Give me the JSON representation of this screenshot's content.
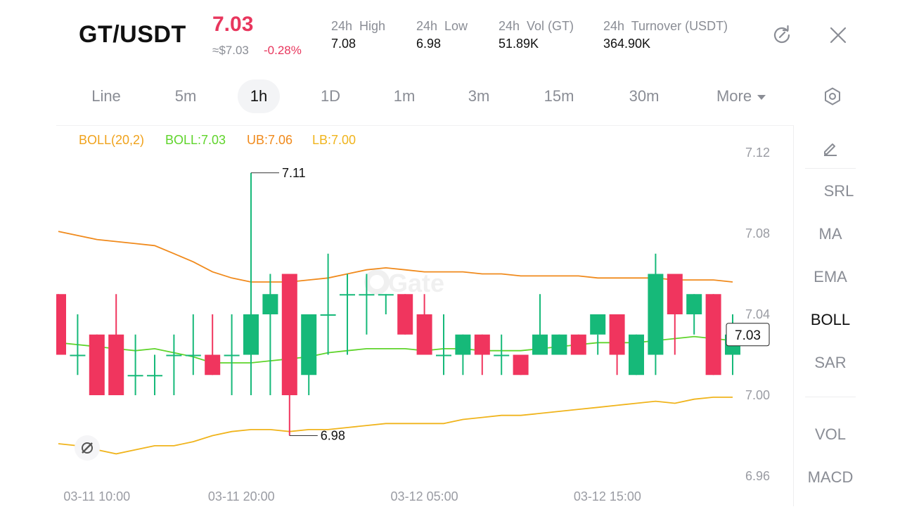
{
  "header": {
    "pair": "GT/USDT",
    "price": "7.03",
    "usd_price": "≈$7.03",
    "change": "-0.28%",
    "stats": [
      {
        "label": "24h  High",
        "value": "7.08"
      },
      {
        "label": "24h  Low",
        "value": "6.98"
      },
      {
        "label": "24h  Vol (GT)",
        "value": "51.89K"
      },
      {
        "label": "24h  Turnover (USDT)",
        "value": "364.90K"
      }
    ],
    "refresh_icon": "refresh-icon",
    "close_icon": "close-icon"
  },
  "timeframes": {
    "items": [
      "Line",
      "5m",
      "1h",
      "1D",
      "1m",
      "3m",
      "15m",
      "30m",
      "More"
    ],
    "active": "1h",
    "settings_icon": "hexagon-settings-icon"
  },
  "legend": {
    "boll": "BOLL(20,2)",
    "mid": "BOLL:7.03",
    "ub": "UB:7.06",
    "lb": "LB:7.00"
  },
  "right_panel": {
    "draw_icon": "pencil-icon",
    "indicators": [
      "SRL",
      "MA",
      "EMA",
      "BOLL",
      "SAR"
    ],
    "active_indicator": "BOLL",
    "sub_indicators": [
      "VOL",
      "MACD"
    ]
  },
  "watermark": "Gate",
  "colors": {
    "up": "#16b979",
    "down": "#f0355e",
    "boll_mid": "#5fd42b",
    "boll_band": "#f0a21c",
    "price_red": "#e8365d"
  },
  "chart_data": {
    "type": "candlestick",
    "y_ticks": [
      "7.12",
      "7.08",
      "7.04",
      "7.00",
      "6.96"
    ],
    "ylim": [
      6.96,
      7.12
    ],
    "x_ticks": [
      "03-11 10:00",
      "03-11 20:00",
      "03-12 05:00",
      "03-12 15:00"
    ],
    "annotations": {
      "high": "7.11",
      "low": "6.98",
      "current": "7.03"
    },
    "candles": [
      {
        "o": 7.05,
        "h": 7.05,
        "l": 7.02,
        "c": 7.02
      },
      {
        "o": 7.02,
        "h": 7.04,
        "l": 7.01,
        "c": 7.02
      },
      {
        "o": 7.03,
        "h": 7.03,
        "l": 7.0,
        "c": 7.0
      },
      {
        "o": 7.03,
        "h": 7.05,
        "l": 7.0,
        "c": 7.0
      },
      {
        "o": 7.01,
        "h": 7.03,
        "l": 7.0,
        "c": 7.01
      },
      {
        "o": 7.01,
        "h": 7.02,
        "l": 7.0,
        "c": 7.01
      },
      {
        "o": 7.02,
        "h": 7.03,
        "l": 7.0,
        "c": 7.02
      },
      {
        "o": 7.02,
        "h": 7.04,
        "l": 7.01,
        "c": 7.02
      },
      {
        "o": 7.02,
        "h": 7.04,
        "l": 7.01,
        "c": 7.01
      },
      {
        "o": 7.02,
        "h": 7.04,
        "l": 7.0,
        "c": 7.02
      },
      {
        "o": 7.02,
        "h": 7.11,
        "l": 7.0,
        "c": 7.04
      },
      {
        "o": 7.04,
        "h": 7.06,
        "l": 7.0,
        "c": 7.05
      },
      {
        "o": 7.06,
        "h": 7.06,
        "l": 6.98,
        "c": 7.0
      },
      {
        "o": 7.01,
        "h": 7.04,
        "l": 7.0,
        "c": 7.04
      },
      {
        "o": 7.04,
        "h": 7.07,
        "l": 7.02,
        "c": 7.04
      },
      {
        "o": 7.05,
        "h": 7.06,
        "l": 7.02,
        "c": 7.05
      },
      {
        "o": 7.05,
        "h": 7.06,
        "l": 7.03,
        "c": 7.05
      },
      {
        "o": 7.05,
        "h": 7.05,
        "l": 7.04,
        "c": 7.05
      },
      {
        "o": 7.05,
        "h": 7.05,
        "l": 7.03,
        "c": 7.03
      },
      {
        "o": 7.04,
        "h": 7.05,
        "l": 7.02,
        "c": 7.02
      },
      {
        "o": 7.02,
        "h": 7.04,
        "l": 7.01,
        "c": 7.02
      },
      {
        "o": 7.02,
        "h": 7.03,
        "l": 7.01,
        "c": 7.03
      },
      {
        "o": 7.03,
        "h": 7.03,
        "l": 7.01,
        "c": 7.02
      },
      {
        "o": 7.02,
        "h": 7.03,
        "l": 7.01,
        "c": 7.02
      },
      {
        "o": 7.02,
        "h": 7.02,
        "l": 7.01,
        "c": 7.01
      },
      {
        "o": 7.02,
        "h": 7.05,
        "l": 7.02,
        "c": 7.03
      },
      {
        "o": 7.02,
        "h": 7.03,
        "l": 7.02,
        "c": 7.03
      },
      {
        "o": 7.03,
        "h": 7.03,
        "l": 7.02,
        "c": 7.02
      },
      {
        "o": 7.03,
        "h": 7.03,
        "l": 7.02,
        "c": 7.04
      },
      {
        "o": 7.04,
        "h": 7.04,
        "l": 7.01,
        "c": 7.02
      },
      {
        "o": 7.01,
        "h": 7.03,
        "l": 7.01,
        "c": 7.03
      },
      {
        "o": 7.02,
        "h": 7.07,
        "l": 7.01,
        "c": 7.06
      },
      {
        "o": 7.06,
        "h": 7.06,
        "l": 7.02,
        "c": 7.04
      },
      {
        "o": 7.04,
        "h": 7.05,
        "l": 7.03,
        "c": 7.05
      },
      {
        "o": 7.05,
        "h": 7.05,
        "l": 7.01,
        "c": 7.01
      },
      {
        "o": 7.02,
        "h": 7.04,
        "l": 7.01,
        "c": 7.03
      }
    ],
    "boll_ub": [
      7.081,
      7.079,
      7.077,
      7.076,
      7.075,
      7.074,
      7.07,
      7.066,
      7.061,
      7.058,
      7.056,
      7.056,
      7.056,
      7.057,
      7.058,
      7.06,
      7.062,
      7.063,
      7.062,
      7.061,
      7.061,
      7.061,
      7.06,
      7.06,
      7.059,
      7.059,
      7.059,
      7.059,
      7.058,
      7.058,
      7.058,
      7.058,
      7.057,
      7.057,
      7.057,
      7.056
    ],
    "boll_mid": [
      7.026,
      7.025,
      7.024,
      7.023,
      7.022,
      7.023,
      7.021,
      7.019,
      7.016,
      7.016,
      7.016,
      7.017,
      7.018,
      7.019,
      7.021,
      7.022,
      7.023,
      7.023,
      7.023,
      7.022,
      7.023,
      7.023,
      7.022,
      7.022,
      7.022,
      7.023,
      7.024,
      7.025,
      7.026,
      7.026,
      7.026,
      7.027,
      7.028,
      7.029,
      7.028,
      7.027
    ],
    "boll_lb": [
      6.976,
      6.975,
      6.973,
      6.971,
      6.973,
      6.975,
      6.975,
      6.977,
      6.98,
      6.982,
      6.983,
      6.983,
      6.982,
      6.983,
      6.983,
      6.984,
      6.985,
      6.986,
      6.986,
      6.986,
      6.986,
      6.988,
      6.989,
      6.99,
      6.99,
      6.991,
      6.992,
      6.993,
      6.994,
      6.995,
      6.996,
      6.997,
      6.996,
      6.998,
      6.999,
      6.999
    ]
  }
}
